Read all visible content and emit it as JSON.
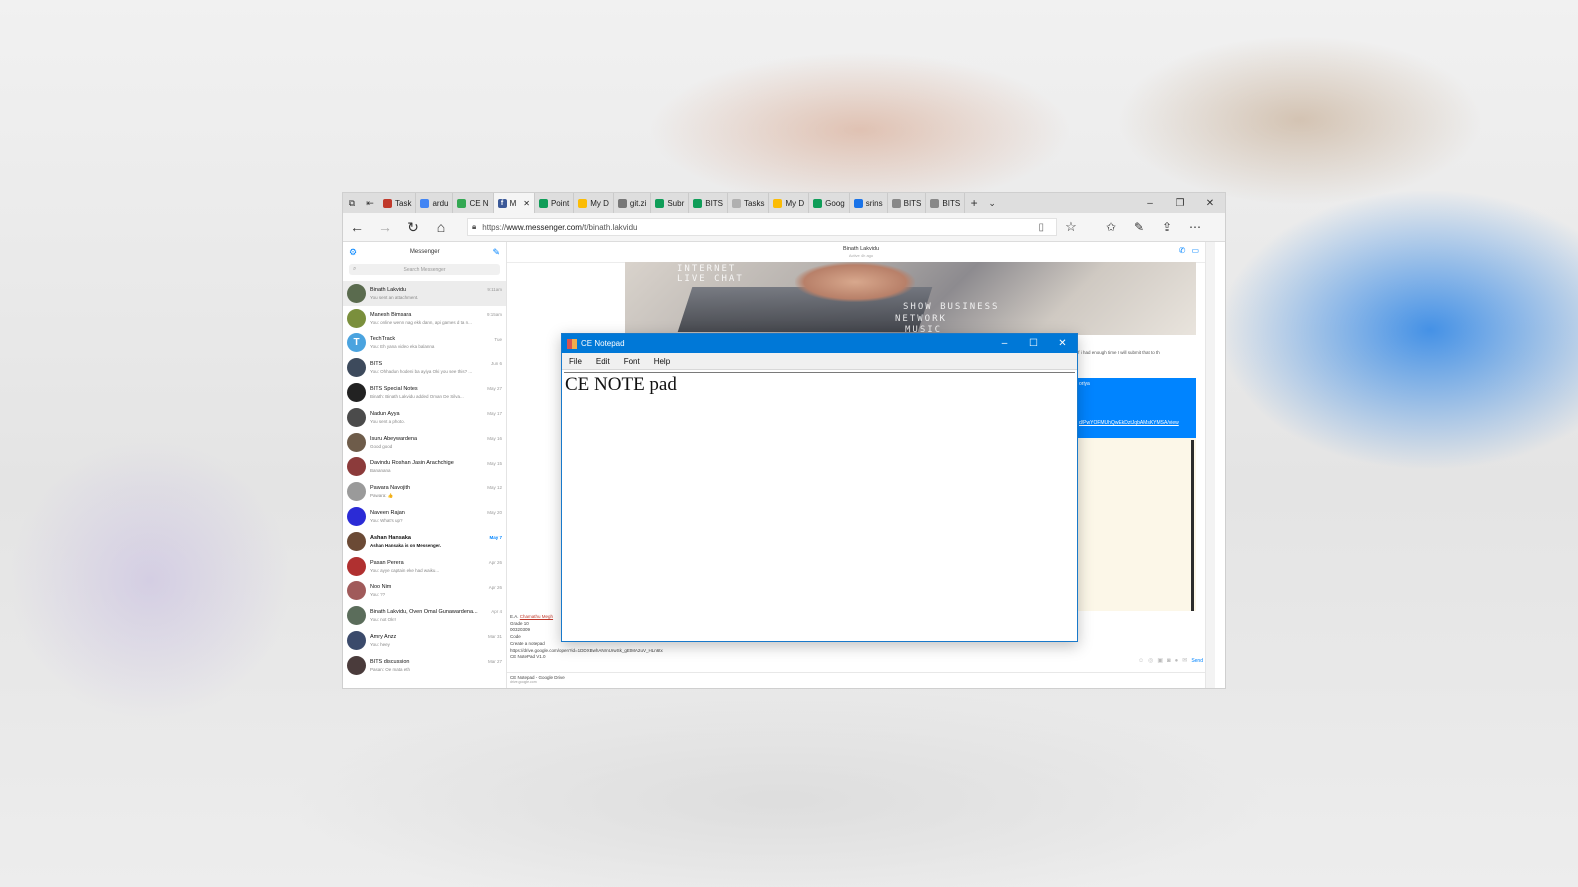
{
  "browser": {
    "tabs": [
      {
        "label": "Task",
        "color": "#c0392b"
      },
      {
        "label": "ardu",
        "color": "#4285f4"
      },
      {
        "label": "CE N",
        "color": "#34a853"
      },
      {
        "label": "M",
        "color": "#3b5998",
        "active": true,
        "letter": "f"
      },
      {
        "label": "Point",
        "color": "#0f9d58"
      },
      {
        "label": "My D",
        "color": "#fbbc05"
      },
      {
        "label": "git.zi",
        "color": "#777777"
      },
      {
        "label": "Subr",
        "color": "#0f9d58"
      },
      {
        "label": "BITS",
        "color": "#0f9d58"
      },
      {
        "label": "Tasks",
        "color": "#b0b0b0"
      },
      {
        "label": "My D",
        "color": "#fbbc05"
      },
      {
        "label": "Goog",
        "color": "#0f9d58"
      },
      {
        "label": "srins",
        "color": "#1a73e8"
      },
      {
        "label": "BITS",
        "color": "#888888"
      },
      {
        "label": "BITS",
        "color": "#888888"
      }
    ],
    "url_prefix": "https://",
    "url_host": "www.messenger.com",
    "url_path": "/t/binath.lakvidu"
  },
  "messenger": {
    "sidebar_title": "Messenger",
    "search_placeholder": "Search Messenger",
    "conversations": [
      {
        "name": "Binath Lakvidu",
        "snippet": "You sent an attachment.",
        "date": "9:11am",
        "color": "#5a6b4e"
      },
      {
        "name": "Manesh Bimsara",
        "snippet": "You: online wenn nag ekk dann, api games d ta n...",
        "date": "9:15am",
        "color": "#7a8f3c"
      },
      {
        "name": "TechTrack",
        "snippet": "You: Eh yana video eka balanna",
        "date": "Tue",
        "color": "#4aa3df",
        "letter": "T"
      },
      {
        "name": "BITS",
        "snippet": "You: Ohhadun hodeni ba ayiya Oki you see this? ...",
        "date": "Jun 6",
        "color": "#3d4a5c"
      },
      {
        "name": "BITS Special Notes",
        "snippet": "Binath: Binath Lakvidu added Oman De Silva...",
        "date": "May 27",
        "color": "#222222"
      },
      {
        "name": "Nadun Ayya",
        "snippet": "You sent a photo.",
        "date": "May 17",
        "color": "#4b4b4b"
      },
      {
        "name": "Isuru Abeywardena",
        "snippet": "Good good",
        "date": "May 16",
        "color": "#6e5c4a"
      },
      {
        "name": "Davindu Roshan Jasin Arachchige",
        "snippet": "Bananana",
        "date": "May 15",
        "color": "#8c3b3b"
      },
      {
        "name": "Pawara Navojith",
        "snippet": "Pawara: 👍",
        "date": "May 12",
        "color": "#9a9a9a"
      },
      {
        "name": "Naveen Rajan",
        "snippet": "You: What's up?",
        "date": "May 20",
        "color": "#2b2bd6"
      },
      {
        "name": "Ashan Hansaka",
        "snippet": "Ashan Hansaka is on Messenger.",
        "date": "May 7",
        "color": "#6b4a35",
        "unread": true
      },
      {
        "name": "Pasan Perera",
        "snippet": "You: ayye captain eke had waiku...",
        "date": "Apr 26",
        "color": "#b03030"
      },
      {
        "name": "Noo Nim",
        "snippet": "You: ??",
        "date": "Apr 26",
        "color": "#a05a5a"
      },
      {
        "name": "Binath Lakvidu, Oven Omal Gunawardena...",
        "snippet": "You: not Ok!!",
        "date": "Apr 4",
        "color": "#5b6d5b"
      },
      {
        "name": "Amry Anzz",
        "snippet": "You: heey",
        "date": "Mar 31",
        "color": "#3b4a6b"
      },
      {
        "name": "BITS discussion",
        "snippet": "Pasan: Oe mata eth",
        "date": "Mar 27",
        "color": "#4a3b3b"
      }
    ],
    "chat_title": "Binath Lakvidu",
    "chat_subtitle": "Active 4h ago",
    "hero_text_1": "SHOW BUSINESS",
    "hero_text_2": "NETWORK",
    "hero_text_3": "MUSIC",
    "hero_text_4": "INTERNET",
    "hero_text_5": "LIVE CHAT",
    "gray_msg": "If i had enough time I will submit that to th",
    "blue_msg_name": "oriya",
    "blue_msg_link": "d/PwYOFMUhQwEkDztJqbAMsKYMSA/view",
    "compose_lines": [
      "Grade 10",
      "00320309",
      "Code",
      "Create a notepad",
      "https://drive.google.com/open?id=1DDXBwhANrnUrwSk_gEtMA2uV_HLn6tx",
      "CE NotePad V1.0"
    ],
    "compose_first_prefix": "E.A. ",
    "compose_first_name": "Chamathu Megh",
    "attachment_title": "CE Notepad - Google Drive",
    "attachment_host": "drive.google.com",
    "send_label": "Send"
  },
  "notepad": {
    "title": "CE Notepad",
    "menu": [
      "File",
      "Edit",
      "Font",
      "Help"
    ],
    "content": "CE NOTE pad"
  }
}
